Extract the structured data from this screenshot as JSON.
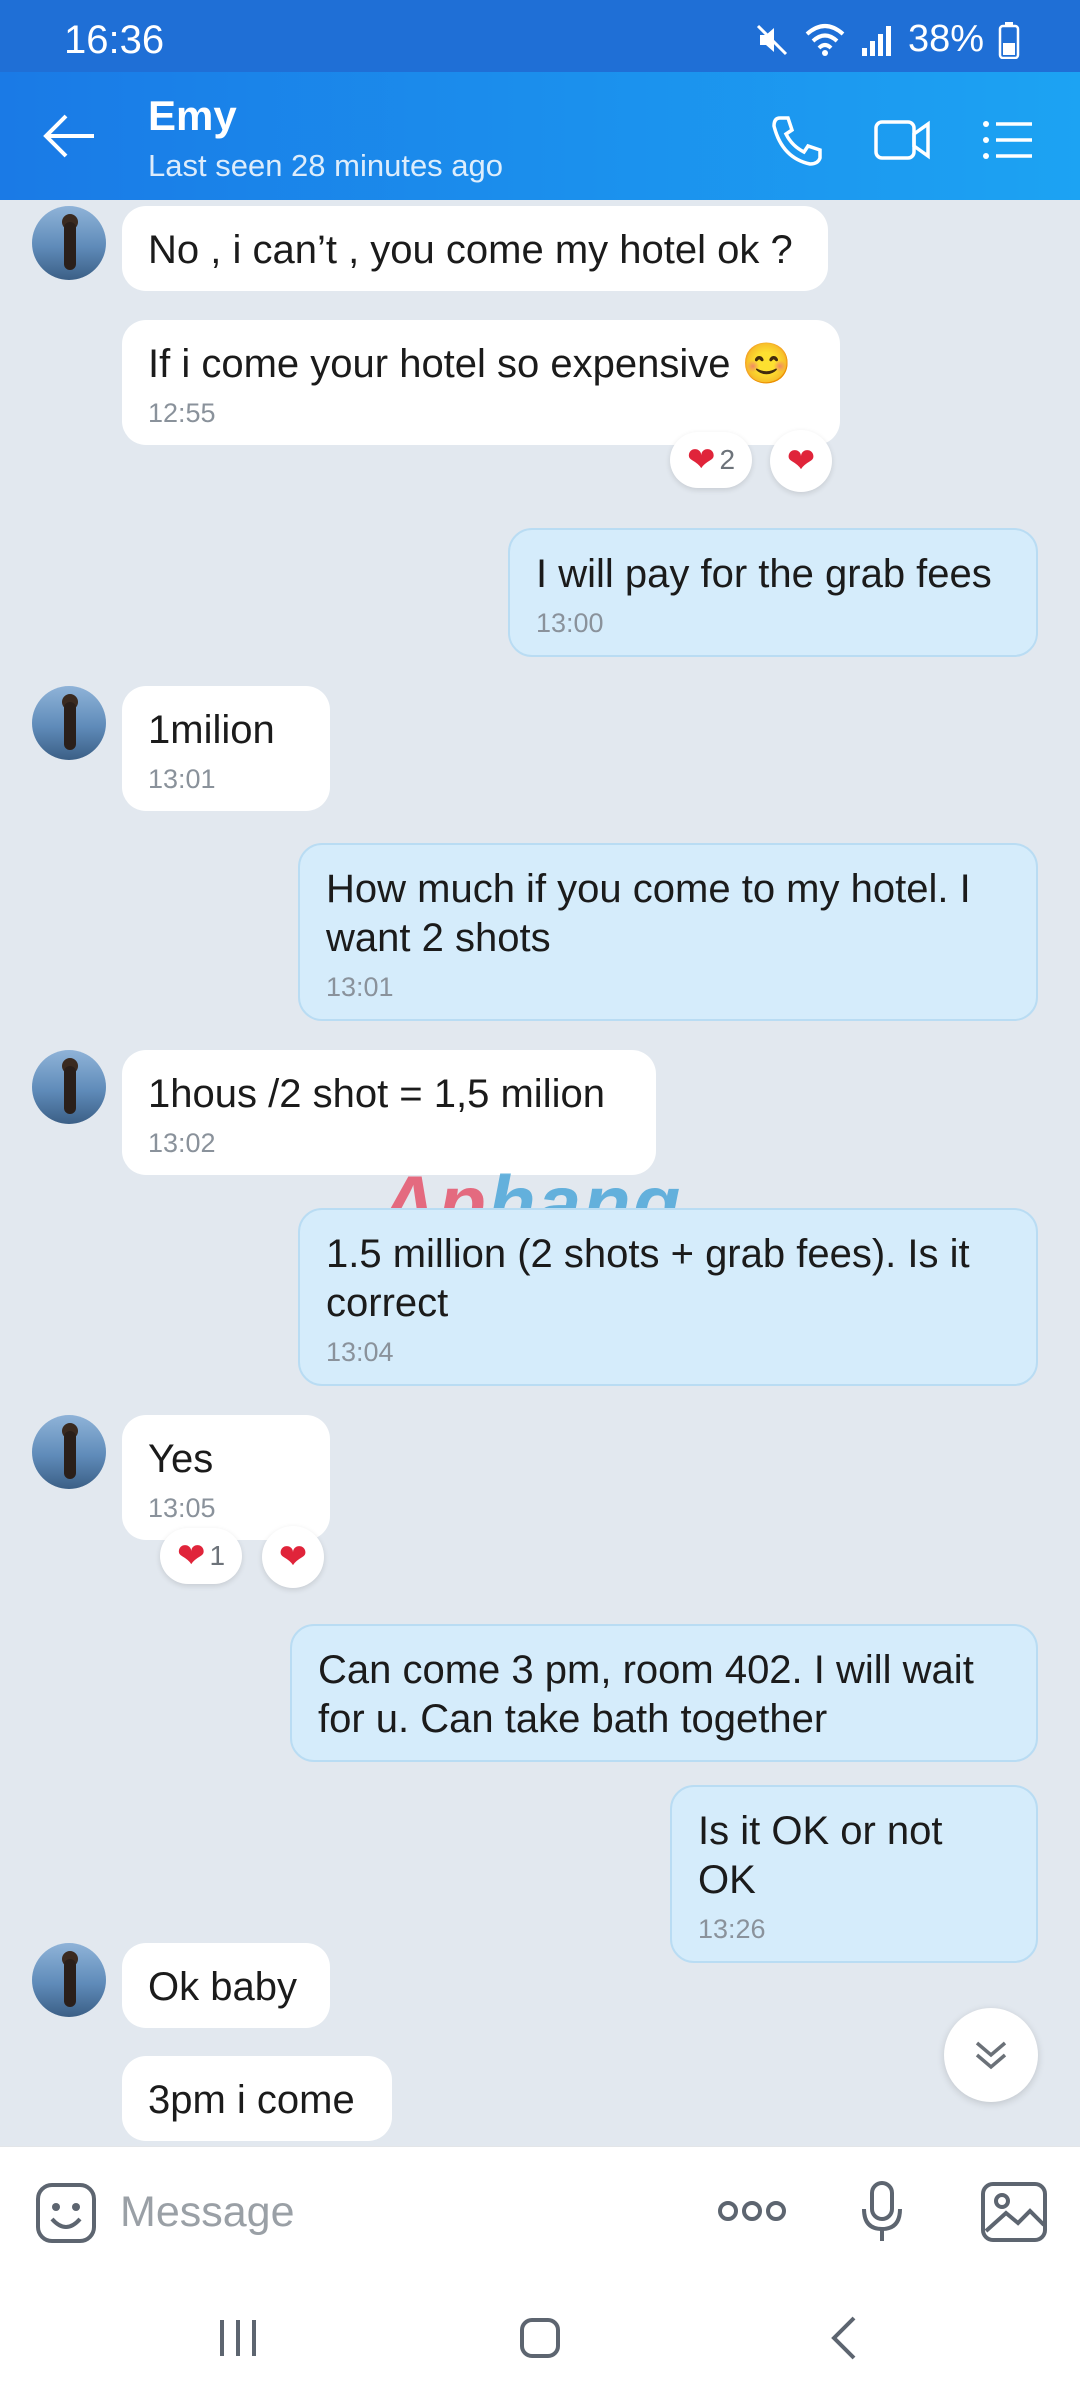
{
  "status_bar": {
    "time": "16:36",
    "battery": "38%",
    "icons": [
      "mute-icon",
      "wifi-icon",
      "signal-icon",
      "battery-icon"
    ]
  },
  "header": {
    "name": "Emy",
    "last_seen": "Last seen 28 minutes ago",
    "icons": [
      "back-arrow-icon",
      "phone-icon",
      "video-call-icon",
      "list-menu-icon"
    ]
  },
  "messages": [
    {
      "from": "them",
      "text": "No , i can’t , you come my hotel ok ?"
    },
    {
      "from": "them",
      "text": "If i come your hotel so expensive 😊",
      "time": "12:55",
      "reactions": {
        "count": "2"
      }
    },
    {
      "from": "me",
      "text": "I will pay for the grab fees",
      "time": "13:00"
    },
    {
      "from": "them",
      "text": "1milion",
      "time": "13:01"
    },
    {
      "from": "me",
      "text": "How much if you come to my hotel. I want 2 shots",
      "time": "13:01"
    },
    {
      "from": "them",
      "text": "1hous /2 shot = 1,5 milion",
      "time": "13:02"
    },
    {
      "from": "me",
      "text": "1.5 million (2 shots + grab fees). Is it correct",
      "time": "13:04"
    },
    {
      "from": "them",
      "text": "Yes",
      "time": "13:05",
      "reactions": {
        "count": "1"
      }
    },
    {
      "from": "me",
      "text": "Can come 3 pm, room 402. I will wait for u. Can take bath together"
    },
    {
      "from": "me",
      "text": "Is it OK or not OK",
      "time": "13:26"
    },
    {
      "from": "them",
      "text": "Ok baby"
    },
    {
      "from": "them",
      "text": "3pm i come"
    }
  ],
  "watermark": {
    "part1": "Ap",
    "part2": "hang"
  },
  "composer": {
    "placeholder": "Message",
    "icons": [
      "sticker-icon",
      "more-icon",
      "microphone-icon",
      "image-icon"
    ]
  },
  "colors": {
    "header_start": "#1a7ae6",
    "header_end": "#1ca3f3",
    "outgoing_bubble": "#d5ecfb",
    "incoming_bubble": "#ffffff",
    "background": "#e2e8ef",
    "heart": "#e0243a"
  }
}
